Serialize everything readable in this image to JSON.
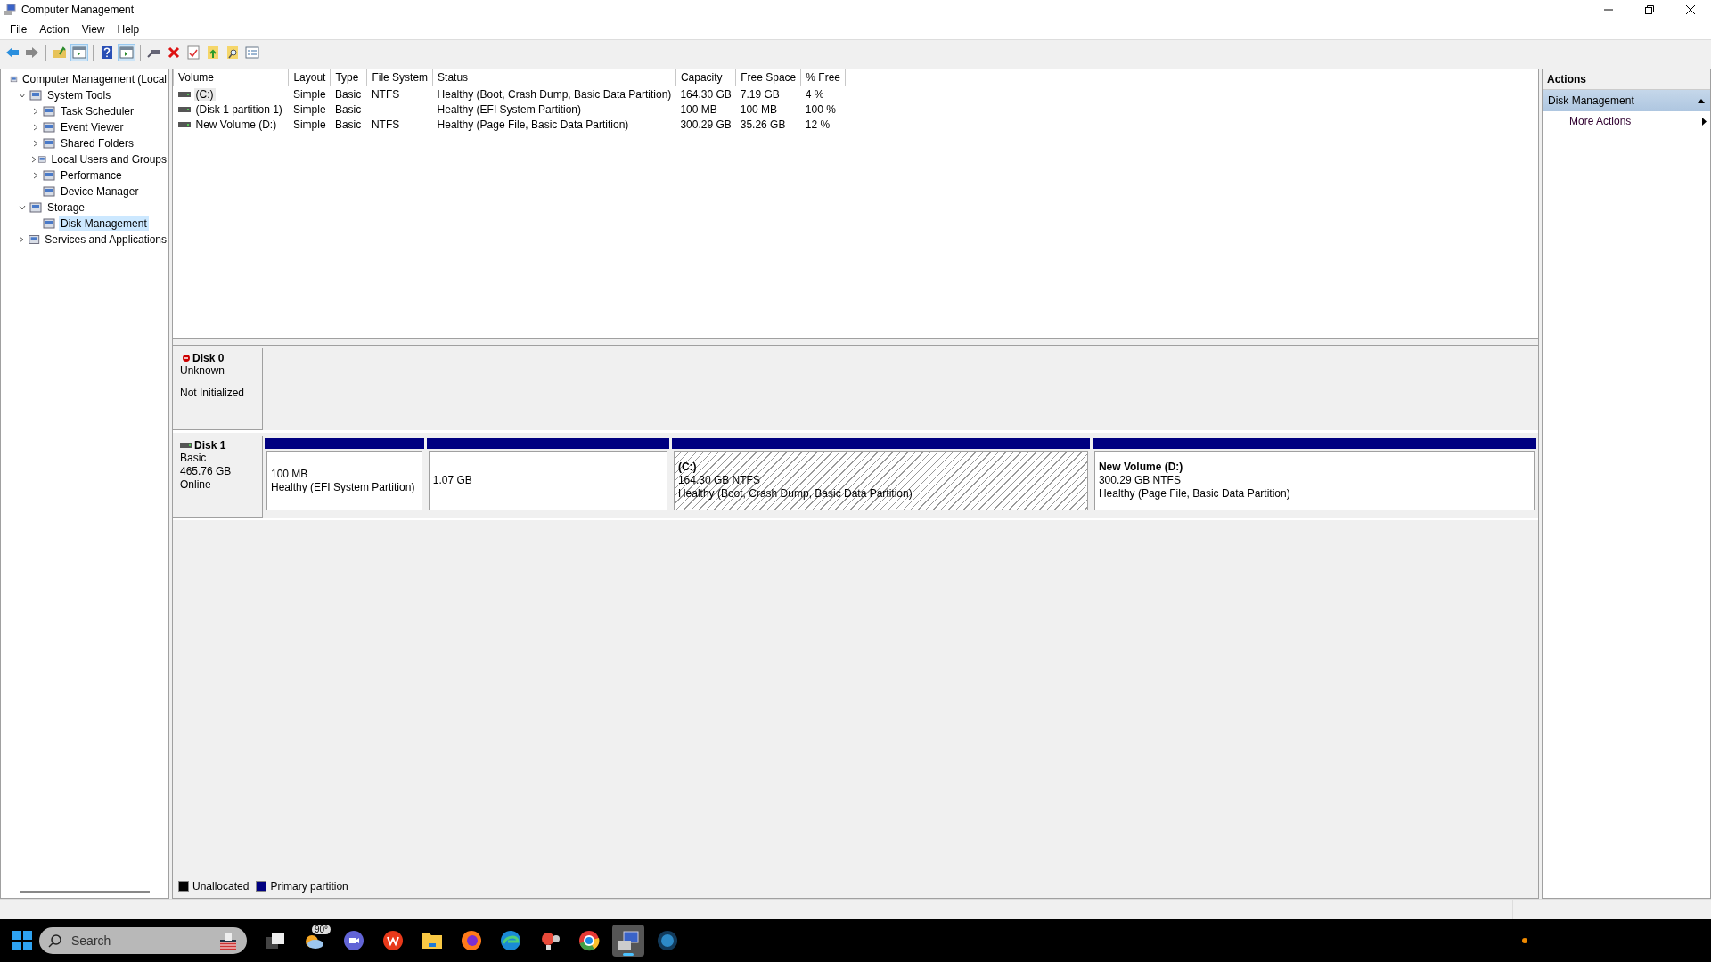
{
  "window": {
    "title": "Computer Management"
  },
  "menu": [
    "File",
    "Action",
    "View",
    "Help"
  ],
  "toolbar": [
    {
      "kind": "back",
      "pressed": false
    },
    {
      "kind": "forward",
      "pressed": false
    },
    {
      "kind": "separator"
    },
    {
      "kind": "up",
      "pressed": false
    },
    {
      "kind": "tree",
      "pressed": true
    },
    {
      "kind": "separator"
    },
    {
      "kind": "help",
      "pressed": false
    },
    {
      "kind": "pane",
      "pressed": true
    },
    {
      "kind": "separator"
    },
    {
      "kind": "connect",
      "pressed": false
    },
    {
      "kind": "delete",
      "pressed": false
    },
    {
      "kind": "check",
      "pressed": false
    },
    {
      "kind": "export",
      "pressed": false
    },
    {
      "kind": "find",
      "pressed": false
    },
    {
      "kind": "list",
      "pressed": false
    }
  ],
  "tree": [
    {
      "label": "Computer Management (Local",
      "selected": false,
      "children": [
        {
          "label": "System Tools",
          "expanded": true,
          "selected": false,
          "children": [
            {
              "label": "Task Scheduler",
              "expanded": false,
              "selected": false
            },
            {
              "label": "Event Viewer",
              "expanded": false,
              "selected": false
            },
            {
              "label": "Shared Folders",
              "expanded": false,
              "selected": false
            },
            {
              "label": "Local Users and Groups",
              "expanded": false,
              "selected": false
            },
            {
              "label": "Performance",
              "expanded": false,
              "selected": false
            },
            {
              "label": "Device Manager",
              "selected": false
            }
          ]
        },
        {
          "label": "Storage",
          "expanded": true,
          "selected": false,
          "children": [
            {
              "label": "Disk Management",
              "selected": true
            }
          ]
        },
        {
          "label": "Services and Applications",
          "expanded": false,
          "selected": false
        }
      ]
    }
  ],
  "table": {
    "columns": [
      "Volume",
      "Layout",
      "Type",
      "File System",
      "Status",
      "Capacity",
      "Free Space",
      "% Free"
    ],
    "rows": [
      {
        "selected": true,
        "cells": [
          "(C:)",
          "Simple",
          "Basic",
          "NTFS",
          "Healthy (Boot, Crash Dump, Basic Data Partition)",
          "164.30 GB",
          "7.19 GB",
          "4 %"
        ]
      },
      {
        "selected": false,
        "cells": [
          "(Disk 1 partition 1)",
          "Simple",
          "Basic",
          "",
          "Healthy (EFI System Partition)",
          "100 MB",
          "100 MB",
          "100 %"
        ]
      },
      {
        "selected": false,
        "cells": [
          "New Volume (D:)",
          "Simple",
          "Basic",
          "NTFS",
          "Healthy (Page File, Basic Data Partition)",
          "300.29 GB",
          "35.26 GB",
          "12 %"
        ]
      }
    ]
  },
  "disks": [
    {
      "kind": "unknown",
      "name": "Disk 0",
      "lines": [
        "Unknown"
      ],
      "note": "Not Initialized"
    },
    {
      "kind": "basic",
      "name": "Disk 1",
      "lines": [
        "Basic",
        "465.76 GB",
        "Online"
      ],
      "partitions": [
        {
          "kind": "primary",
          "selected": false,
          "lines": [
            "100 MB",
            "Healthy (EFI System Partition)"
          ]
        },
        {
          "kind": "primary",
          "selected": false,
          "lines": [
            "1.07 GB"
          ]
        },
        {
          "kind": "primary",
          "selected": true,
          "name": "(C:)",
          "lines": [
            "164.30 GB NTFS",
            "Healthy (Boot, Crash Dump, Basic Data Partition)"
          ]
        },
        {
          "kind": "primary",
          "selected": false,
          "name": "New Volume  (D:)",
          "lines": [
            "300.29 GB NTFS",
            "Healthy (Page File, Basic Data Partition)"
          ]
        }
      ]
    }
  ],
  "legend": [
    {
      "label": "Unallocated",
      "color": "#000000"
    },
    {
      "label": "Primary partition",
      "color": "#000080"
    }
  ],
  "actions": {
    "title": "Actions",
    "section": {
      "label": "Disk Management",
      "expanded": true
    },
    "items": [
      "More Actions"
    ]
  },
  "taskbar": {
    "search": {
      "placeholder": "Search"
    },
    "weather": "90°",
    "apps": [
      {
        "kind": "taskview",
        "selected": false
      },
      {
        "kind": "weather",
        "selected": false
      },
      {
        "kind": "chat",
        "selected": false
      },
      {
        "kind": "office",
        "selected": false
      },
      {
        "kind": "folder",
        "selected": false
      },
      {
        "kind": "firefox",
        "selected": false
      },
      {
        "kind": "edge",
        "selected": false
      },
      {
        "kind": "bulb",
        "selected": false
      },
      {
        "kind": "chrome",
        "selected": false
      },
      {
        "kind": "mmc",
        "selected": true
      },
      {
        "kind": "globe",
        "selected": false
      }
    ]
  }
}
